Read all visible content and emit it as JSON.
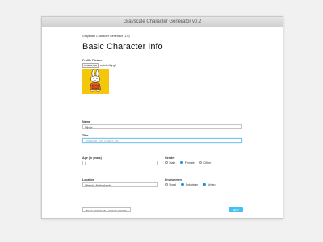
{
  "window": {
    "title": "Grayscale Character Generator v0.2"
  },
  "header": {
    "breadcrumb": "Grayscale Character Generator (1.0)",
    "page_title": "Basic Character Info"
  },
  "profile_picture": {
    "label": "Profile Picture",
    "choose_file": "Choose File",
    "file_name": "artistmiffy.gif"
  },
  "name": {
    "label": "Name",
    "value": "Nijntje"
  },
  "title": {
    "label": "Title",
    "placeholder": "The Artist, The Dealer, etc."
  },
  "age": {
    "label": "Age (in years)",
    "value": "5"
  },
  "gender": {
    "label": "Gender",
    "options": [
      "Male",
      "Female",
      "Other"
    ],
    "selected": "Female"
  },
  "location": {
    "label": "Location",
    "value": "Utrecht, Netherlands"
  },
  "environment": {
    "label": "Environment",
    "options": [
      "Rural",
      "Suburban",
      "Urban"
    ],
    "selected": "Urban"
  },
  "actions": {
    "back_label": "BACK (INPUT WILL NOT BE SAVED)",
    "next_label": "NEXT"
  },
  "colors": {
    "accent": "#43c2ee",
    "picture_bg": "#f5c70b"
  }
}
